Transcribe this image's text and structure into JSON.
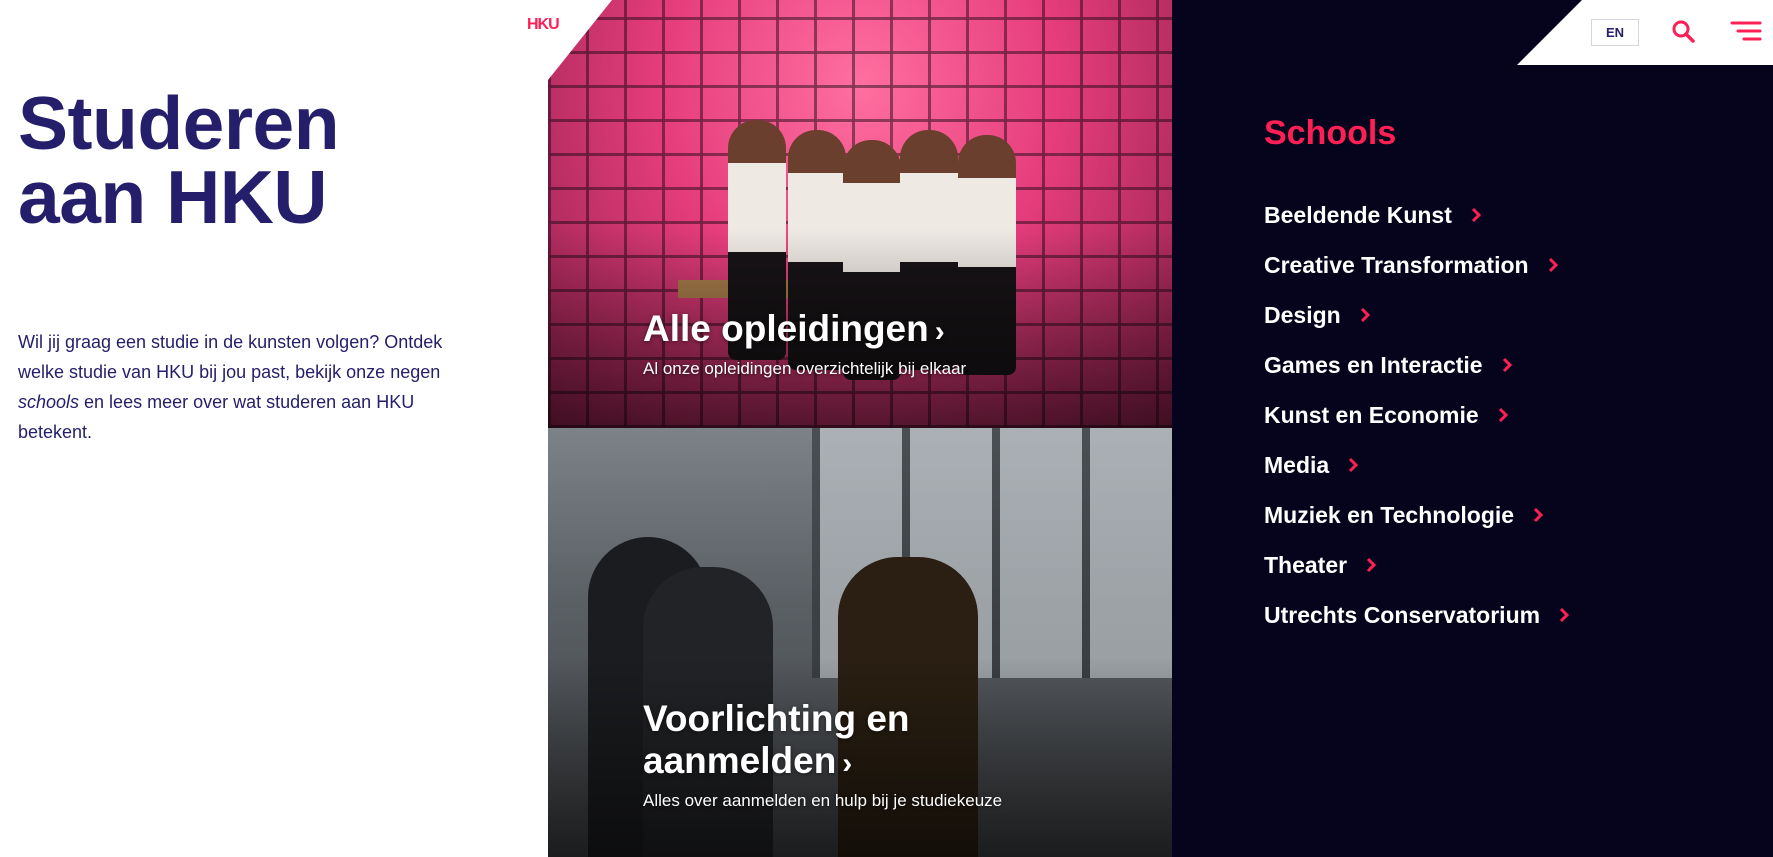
{
  "header": {
    "logo_text": "HKU",
    "language_label": "EN"
  },
  "intro": {
    "title_line1": "Studeren",
    "title_line2": "aan HKU",
    "text_part1": "Wil jij graag een studie in de kunsten volgen? Ontdek welke studie van HKU bij jou past, bekijk onze negen ",
    "text_italic": "schools",
    "text_part2": " en lees meer over wat studeren aan HKU betekent."
  },
  "tiles": [
    {
      "heading": "Alle opleidingen",
      "subtitle": "Al onze opleidingen overzichtelijk bij elkaar"
    },
    {
      "heading_line1": "Voorlichting en",
      "heading_line2": "aanmelden",
      "subtitle": "Alles over aanmelden en hulp bij je studiekeuze"
    }
  ],
  "schools": {
    "heading": "Schools",
    "items": [
      "Beeldende Kunst",
      "Creative Transformation",
      "Design",
      "Games en Interactie",
      "Kunst en Economie",
      "Media",
      "Muziek en Technologie",
      "Theater",
      "Utrechts Conservatorium"
    ]
  },
  "colors": {
    "brand_red": "#ff1f55",
    "navy": "#241e6b",
    "dark_panel": "#05041c"
  },
  "icons": {
    "search": "search-icon",
    "menu": "hamburger-menu-icon",
    "chevron": "chevron-right-icon"
  }
}
